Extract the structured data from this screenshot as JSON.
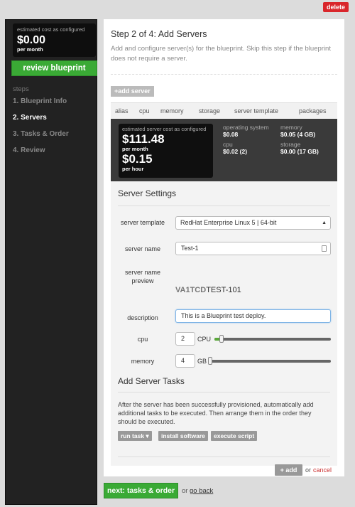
{
  "header": {
    "delete_label": "delete"
  },
  "sidebar": {
    "cost_label": "estimated cost as configured",
    "cost_value": "$0.00",
    "cost_period": "per month",
    "review_label": "review blueprint",
    "steps_heading": "steps",
    "steps": [
      "1. Blueprint Info",
      "2. Servers",
      "3. Tasks & Order",
      "4. Review"
    ],
    "active_step": 1
  },
  "main": {
    "title": "Step 2 of 4: Add Servers",
    "description": "Add and configure server(s) for the blueprint. Skip this step if the blueprint does not require a server.",
    "add_server_label": "+add server",
    "columns": [
      "alias",
      "cpu",
      "memory",
      "storage",
      "server template",
      "packages"
    ]
  },
  "summary": {
    "cost_label": "estimated server cost as configured",
    "monthly_value": "$111.48",
    "monthly_period": "per month",
    "hourly_value": "$0.15",
    "hourly_period": "per hour",
    "os_label": "operating system",
    "os_value": "$0.08",
    "memory_label": "memory",
    "memory_value": "$0.05 (4 GB)",
    "cpu_label": "cpu",
    "cpu_value": "$0.02 (2)",
    "storage_label": "storage",
    "storage_value": "$0.00 (17 GB)"
  },
  "settings": {
    "heading": "Server Settings",
    "template_label": "server template",
    "template_value": "RedHat Enterprise Linux 5 | 64-bit",
    "name_label": "server name",
    "name_value": "Test-1",
    "preview_label": "server name preview",
    "preview_prefix": "VA1TCD",
    "preview_suffix": "TEST-101",
    "description_label": "description",
    "description_value": "This is a Blueprint test deploy.",
    "cpu_label": "cpu",
    "cpu_value": "2",
    "cpu_unit": "CPU",
    "cpu_fraction": 0.06,
    "memory_label": "memory",
    "memory_value": "4",
    "memory_unit": "GB",
    "memory_fraction": 0.02
  },
  "tasks": {
    "heading": "Add Server Tasks",
    "description": "After the server has been successfully provisioned, automatically add additional tasks to be executed. Then arrange them in the order they should be executed.",
    "run_task_label": "run task ▾",
    "install_software_label": "install software",
    "execute_script_label": "execute script",
    "add_label": "+ add",
    "or_label": "or",
    "cancel_label": "cancel"
  },
  "footer": {
    "next_label": "next: tasks & order",
    "or_label": "or",
    "back_label": "go back"
  }
}
